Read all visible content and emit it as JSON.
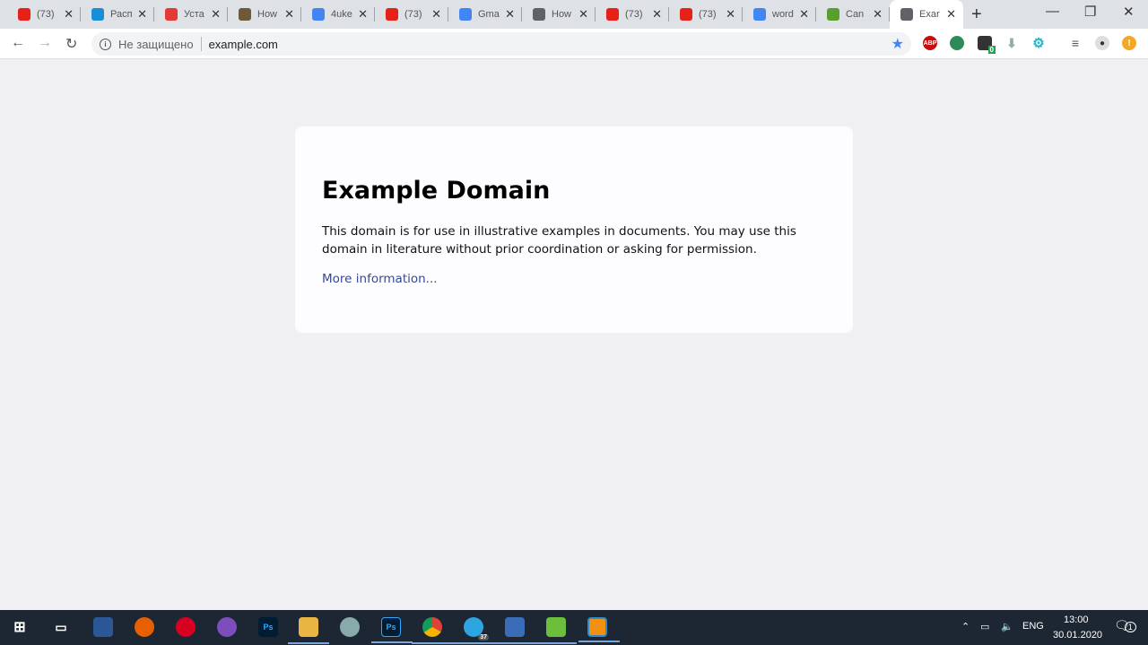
{
  "tabs": [
    {
      "title": "(73)",
      "icon": "youtube-icon",
      "color": "#e62117"
    },
    {
      "title": "Расп",
      "icon": "vps-icon",
      "color": "#1a8fd8"
    },
    {
      "title": "Уста",
      "icon": "monitor-icon",
      "color": "#e53935"
    },
    {
      "title": "How",
      "icon": "image-icon",
      "color": "#6d5a3a"
    },
    {
      "title": "4uke",
      "icon": "google-icon",
      "color": "#4285f4"
    },
    {
      "title": "(73)",
      "icon": "youtube-icon",
      "color": "#e62117"
    },
    {
      "title": "Gma",
      "icon": "google-icon",
      "color": "#4285f4"
    },
    {
      "title": "How",
      "icon": "globe-icon",
      "color": "#5f6368"
    },
    {
      "title": "(73)",
      "icon": "youtube-icon",
      "color": "#e62117"
    },
    {
      "title": "(73)",
      "icon": "youtube-icon",
      "color": "#e62117"
    },
    {
      "title": "word",
      "icon": "docs-icon",
      "color": "#4285f4"
    },
    {
      "title": "Can",
      "icon": "a-icon",
      "color": "#5a9e2f"
    },
    {
      "title": "Exar",
      "icon": "globe-icon",
      "color": "#5f6368",
      "active": true
    }
  ],
  "address": {
    "security": "Не защищено",
    "url": "example.com"
  },
  "extensions": {
    "abp": "ABP",
    "badge": "0"
  },
  "page": {
    "title": "Example Domain",
    "body": "This domain is for use in illustrative examples in documents. You may use this domain in literature without prior coordination or asking for permission.",
    "link": "More information..."
  },
  "taskbar": {
    "lang": "ENG",
    "time": "13:00",
    "date": "30.01.2020",
    "notifications": "1",
    "telegram_badge": "37"
  }
}
